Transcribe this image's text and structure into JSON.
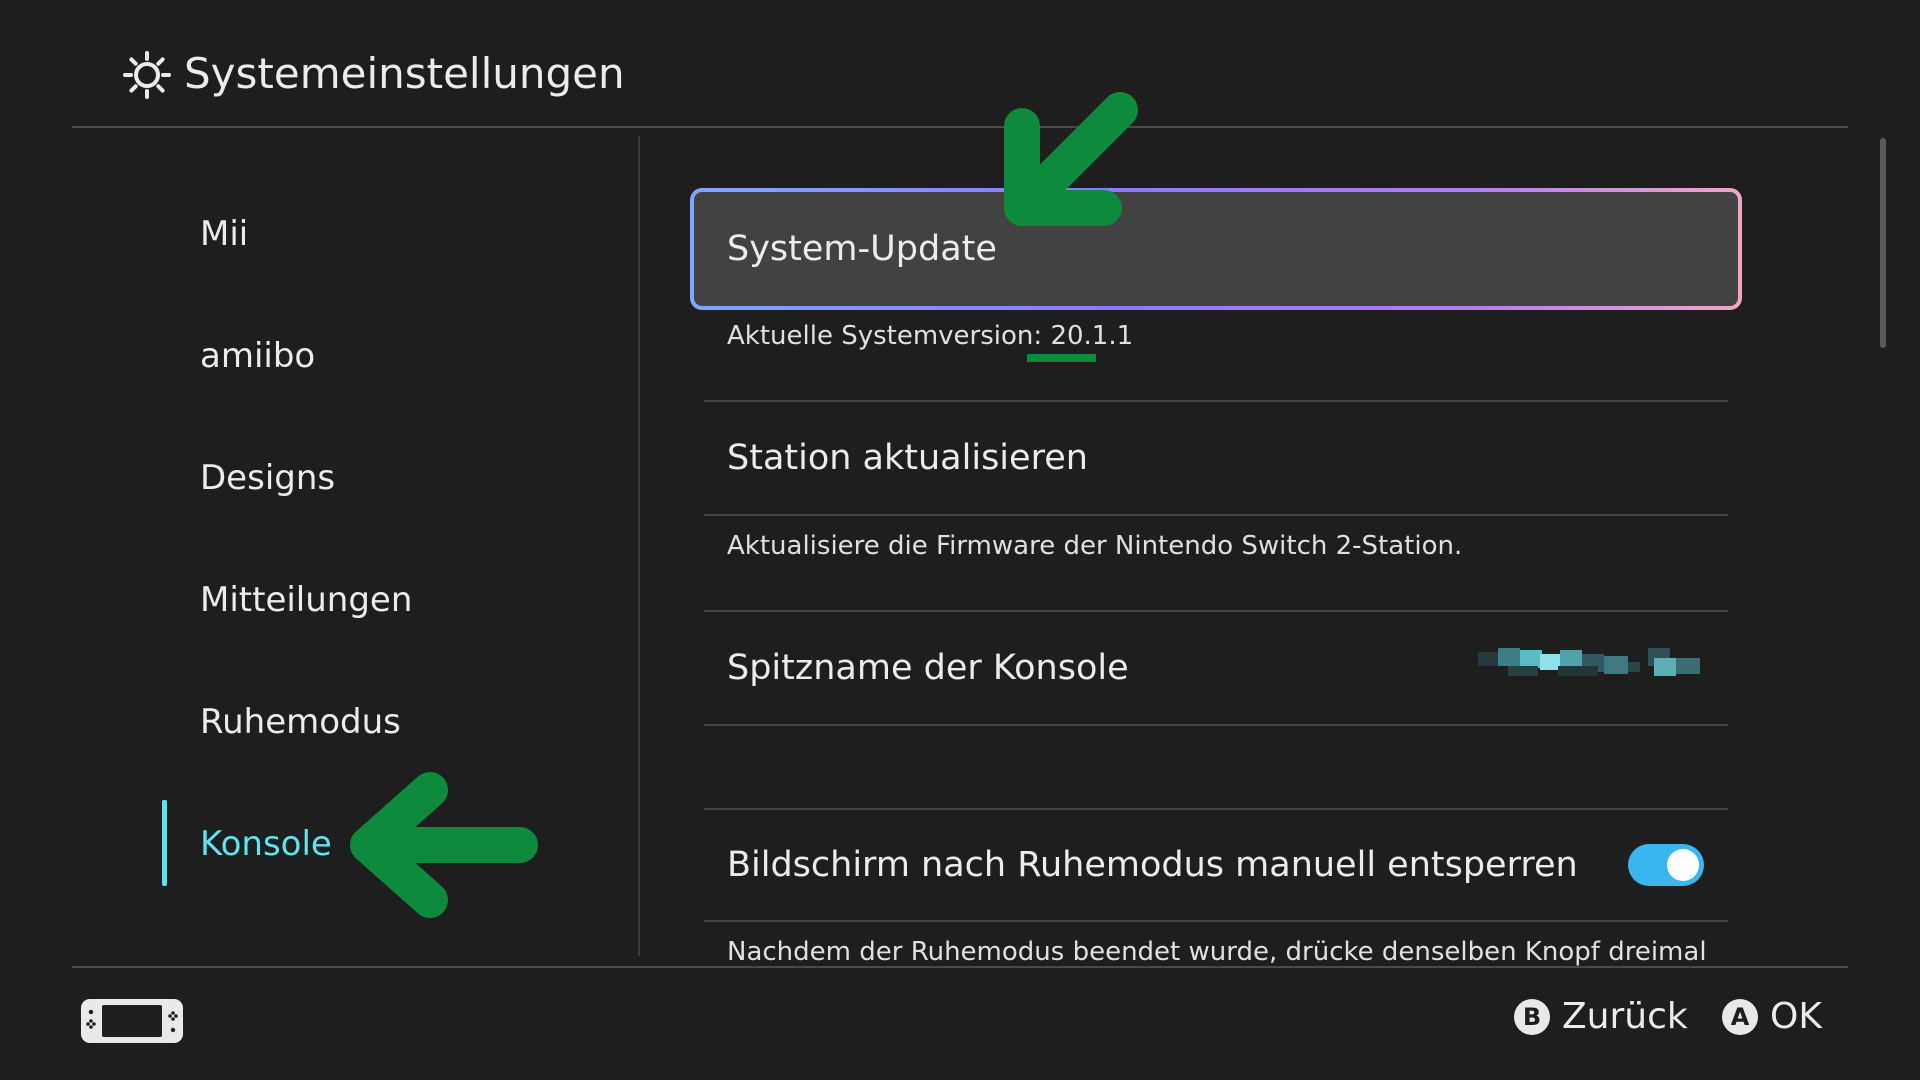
{
  "header": {
    "title": "Systemeinstellungen",
    "icon": "gear-icon"
  },
  "sidebar": {
    "items": [
      {
        "label": "Mii"
      },
      {
        "label": "amiibo"
      },
      {
        "label": "Designs"
      },
      {
        "label": "Mitteilungen"
      },
      {
        "label": "Ruhemodus"
      },
      {
        "label": "Konsole",
        "active": true
      }
    ],
    "accent_color": "#5fe3ee"
  },
  "main": {
    "system_update": {
      "title": "System-Update",
      "version_label": "Aktuelle Systemversion:",
      "version_value": "20.1.1"
    },
    "station_update": {
      "title": "Station aktualisieren",
      "description": "Aktualisiere die Firmware der Nintendo Switch 2-Station."
    },
    "nickname": {
      "title": "Spitzname der Konsole"
    },
    "unlock_screen": {
      "title": "Bildschirm nach Ruhemodus manuell entsperren",
      "enabled": true,
      "description": "Nachdem der Ruhemodus beendet wurde, drücke denselben Knopf dreimal"
    }
  },
  "footer": {
    "back_label": "Zurück",
    "back_glyph": "B",
    "ok_label": "OK",
    "ok_glyph": "A",
    "console_icon": "console-icon"
  },
  "colors": {
    "background": "#1e1e1e",
    "selection_gradient": [
      "#7da8ff",
      "#8d78ff",
      "#f0a6c8"
    ],
    "toggle_on": "#3ab6ee",
    "annotation_arrow": "#0e8a3c"
  }
}
